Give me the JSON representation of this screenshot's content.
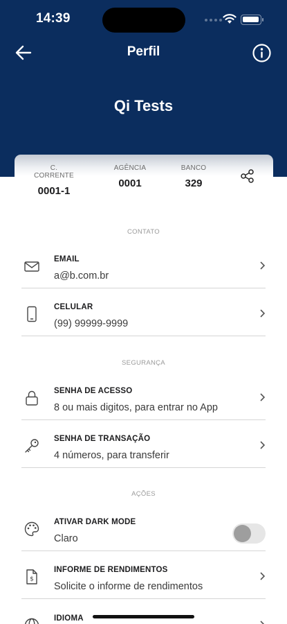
{
  "status_bar": {
    "time": "14:39"
  },
  "header": {
    "title": "Perfil",
    "profile_name": "Qi Tests"
  },
  "account": {
    "conta_label": "C. CORRENTE",
    "conta_value": "0001-1",
    "agencia_label": "AGÊNCIA",
    "agencia_value": "0001",
    "banco_label": "BANCO",
    "banco_value": "329"
  },
  "sections": {
    "contato": "CONTATO",
    "seguranca": "SEGURANÇA",
    "acoes": "AÇÕES"
  },
  "rows": {
    "email": {
      "title": "EMAIL",
      "value": "a@b.com.br",
      "icon": "envelope-icon"
    },
    "celular": {
      "title": "CELULAR",
      "value": "(99)  99999-9999",
      "icon": "phone-icon"
    },
    "senha_acesso": {
      "title": "SENHA DE ACESSO",
      "value": "8 ou mais digitos, para entrar no App",
      "icon": "lock-icon"
    },
    "senha_transacao": {
      "title": "SENHA DE TRANSAÇÃO",
      "value": "4 números, para transferir",
      "icon": "key-icon"
    },
    "dark_mode": {
      "title": "ATIVAR DARK MODE",
      "value": "Claro",
      "icon": "palette-icon",
      "enabled": false
    },
    "informe": {
      "title": "INFORME DE RENDIMENTOS",
      "value": "Solicite o informe de rendimentos",
      "icon": "document-icon"
    },
    "idioma": {
      "title": "IDIOMA",
      "icon": "globe-icon"
    }
  },
  "colors": {
    "header_bg": "#0b2d5e",
    "background": "#ffffff",
    "divider": "#d5d5d5"
  }
}
